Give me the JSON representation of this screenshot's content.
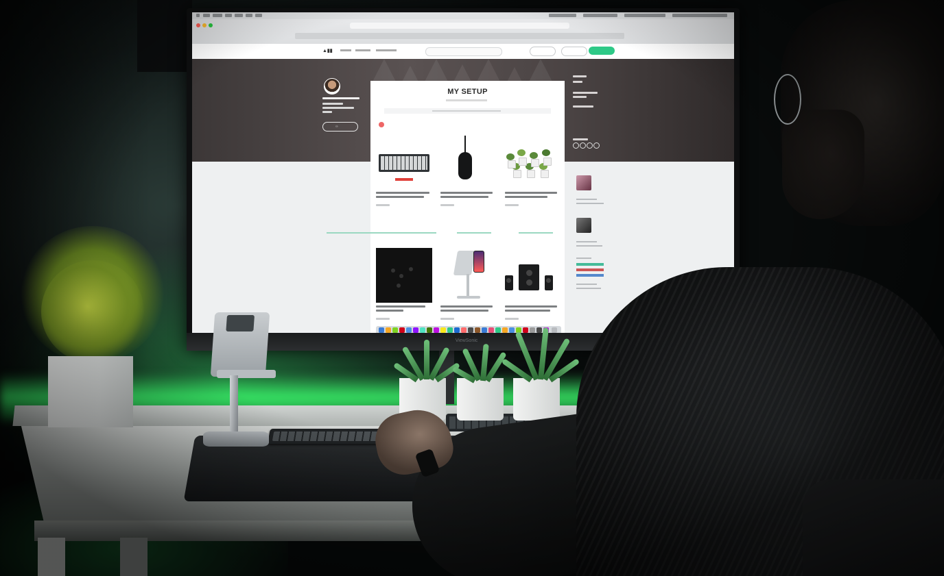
{
  "screen": {
    "card_title": "MY SETUP"
  },
  "monitor": {
    "brand": "ViewSonic"
  },
  "colors": {
    "accent_green": "#2ec987",
    "led_green": "#3cff6e",
    "hero_band": "#4a4343"
  },
  "icons": [
    "apple-icon",
    "avatar",
    "follow-user-icon",
    "search-icon",
    "dock-icons"
  ]
}
